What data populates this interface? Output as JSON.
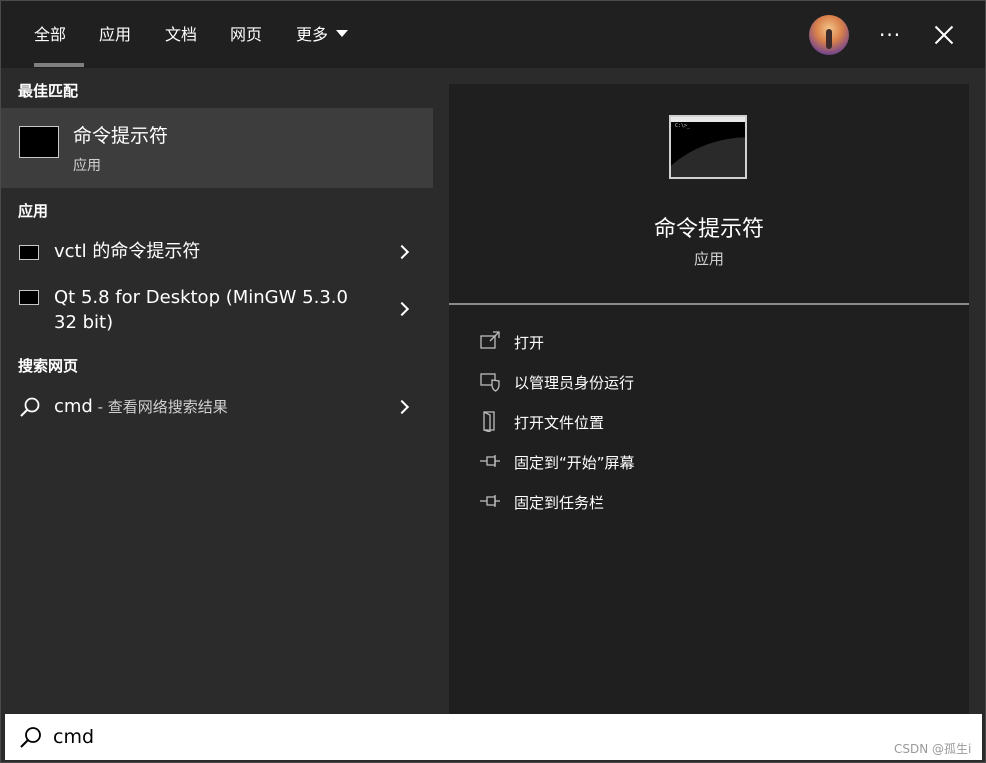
{
  "tabs": [
    {
      "label": "全部"
    },
    {
      "label": "应用"
    },
    {
      "label": "文档"
    },
    {
      "label": "网页"
    },
    {
      "label": "更多"
    }
  ],
  "header": {
    "more_icon": "ellipsis-icon",
    "close_icon": "close-icon",
    "avatar": "user-avatar"
  },
  "best_match": {
    "section_title": "最佳匹配",
    "title": "命令提示符",
    "subtitle": "应用",
    "icon": "command-prompt-icon"
  },
  "apps": {
    "section_title": "应用",
    "items": [
      {
        "label": "vctl 的命令提示符",
        "icon": "command-prompt-icon"
      },
      {
        "label_line1": "Qt 5.8 for Desktop (MinGW 5.3.0",
        "label_line2": "32 bit)",
        "icon": "command-prompt-icon"
      }
    ]
  },
  "web": {
    "section_title": "搜索网页",
    "query": "cmd",
    "suffix": " - 查看网络搜索结果",
    "icon": "search-icon"
  },
  "preview": {
    "title": "命令提示符",
    "subtitle": "应用",
    "icon_text": "C:\\>_",
    "actions": [
      {
        "label": "打开",
        "icon": "open-icon"
      },
      {
        "label": "以管理员身份运行",
        "icon": "shield-icon"
      },
      {
        "label": "打开文件位置",
        "icon": "file-location-icon"
      },
      {
        "label": "固定到“开始”屏幕",
        "icon": "pin-icon"
      },
      {
        "label": "固定到任务栏",
        "icon": "pin-icon"
      }
    ]
  },
  "search": {
    "value": "cmd",
    "icon": "search-icon"
  },
  "watermark": "CSDN @孤生i",
  "colors": {
    "topbar": "#202020",
    "left_bg": "#2b2b2b",
    "right_bg": "#1f1f1f",
    "highlight": "#3d3d3d"
  }
}
